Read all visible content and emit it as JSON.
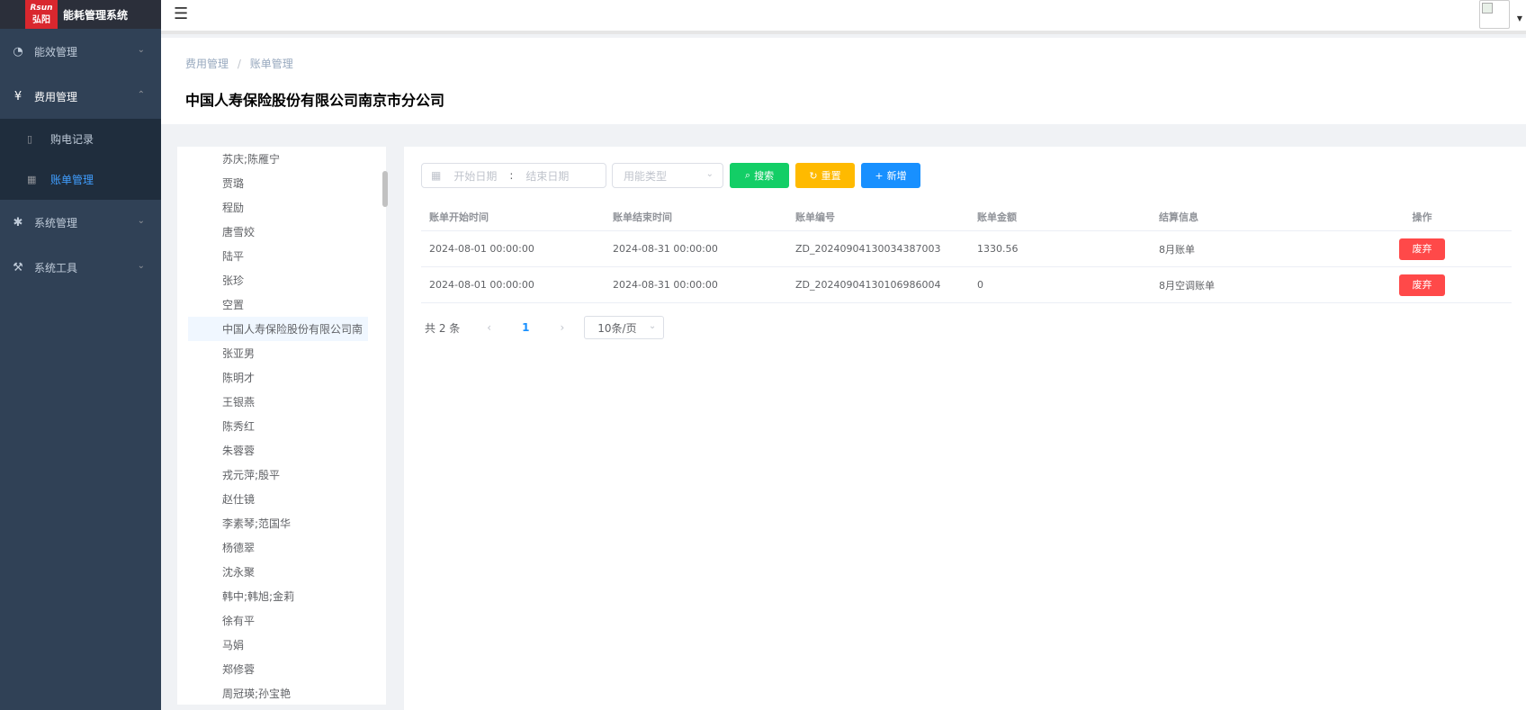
{
  "sidebar": {
    "logo_top": "Rsun",
    "logo_bottom": "弘阳",
    "app_title": "能耗管理系统",
    "menu": [
      {
        "label": "能效管理",
        "icon": "dashboard-icon"
      },
      {
        "label": "费用管理",
        "icon": "yen-icon"
      },
      {
        "label": "系统管理",
        "icon": "gear-icon"
      },
      {
        "label": "系统工具",
        "icon": "tools-icon"
      }
    ],
    "submenu": [
      {
        "label": "购电记录",
        "icon": "document-icon"
      },
      {
        "label": "账单管理",
        "icon": "grid-icon"
      }
    ]
  },
  "breadcrumb": {
    "parent": "费用管理",
    "separator": "/",
    "current": "账单管理"
  },
  "page_title": "中国人寿保险股份有限公司南京市分公司",
  "tree": {
    "nodes": [
      "苏庆;陈雁宁",
      "贾璐",
      "程励",
      "唐雪姣",
      "陆平",
      "张珍",
      "空置",
      "中国人寿保险股份有限公司南",
      "张亚男",
      "陈明才",
      "王银燕",
      "陈秀红",
      "朱蓉蓉",
      "戎元萍;殷平",
      "赵仕镜",
      "李素琴;范国华",
      "杨德翠",
      "沈永聚",
      "韩中;韩旭;金莉",
      "徐有平",
      "马娟",
      "郑修蓉",
      "周冠瑛;孙宝艳"
    ],
    "selected_index": 7
  },
  "filters": {
    "start_placeholder": "开始日期",
    "range_separator": ":",
    "end_placeholder": "结束日期",
    "energy_type_placeholder": "用能类型",
    "search_label": "搜索",
    "reset_label": "重置",
    "add_label": "新增"
  },
  "table": {
    "columns": [
      "账单开始时间",
      "账单结束时间",
      "账单编号",
      "账单金额",
      "结算信息",
      "操作"
    ],
    "rows": [
      {
        "start": "2024-08-01 00:00:00",
        "end": "2024-08-31 00:00:00",
        "code": "ZD_20240904130034387003",
        "amount": "1330.56",
        "info": "8月账单",
        "action": "废弃"
      },
      {
        "start": "2024-08-01 00:00:00",
        "end": "2024-08-31 00:00:00",
        "code": "ZD_20240904130106986004",
        "amount": "0",
        "info": "8月空调账单",
        "action": "废弃"
      }
    ]
  },
  "pagination": {
    "total": "共 2 条",
    "current_page": "1",
    "page_size": "10条/页"
  },
  "colors": {
    "sidebar_bg": "#304156",
    "active": "#409eff",
    "search": "#13ce66",
    "reset": "#ffba00",
    "add": "#1890ff",
    "danger": "#ff4949"
  }
}
